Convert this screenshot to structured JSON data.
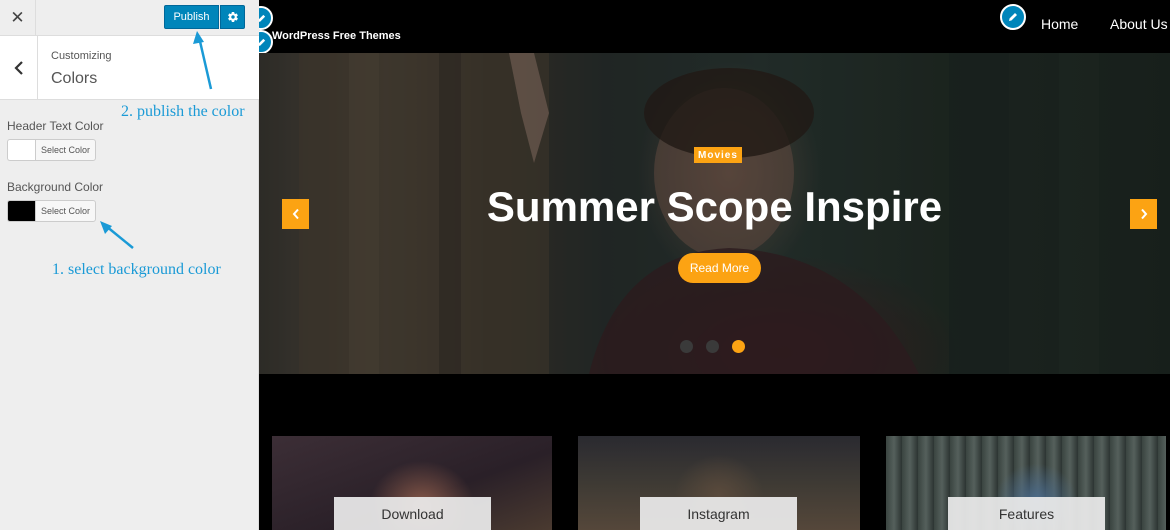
{
  "customizer": {
    "close_glyph": "✕",
    "publish_label": "Publish",
    "section": {
      "breadcrumb": "Customizing",
      "title": "Colors"
    },
    "controls": [
      {
        "label": "Header Text Color",
        "button": "Select Color",
        "swatch_color": "#ffffff"
      },
      {
        "label": "Background Color",
        "button": "Select Color",
        "swatch_color": "#000000"
      }
    ],
    "annotations": {
      "publish": "2. publish the color",
      "select": "1. select background color"
    }
  },
  "site": {
    "title": "WordPress Free Themes",
    "nav": [
      "Home",
      "About Us"
    ],
    "slider": {
      "tag": "Movies",
      "heading": "Summer Scope Inspire",
      "button": "Read More",
      "dots": 3,
      "active_dot": 3
    },
    "cards": [
      {
        "label": "Download"
      },
      {
        "label": "Instagram"
      },
      {
        "label": "Features"
      }
    ]
  },
  "colors": {
    "wp_blue": "#0085ba",
    "accent_orange": "#fca313",
    "annotation_blue": "#1a9ad6"
  }
}
